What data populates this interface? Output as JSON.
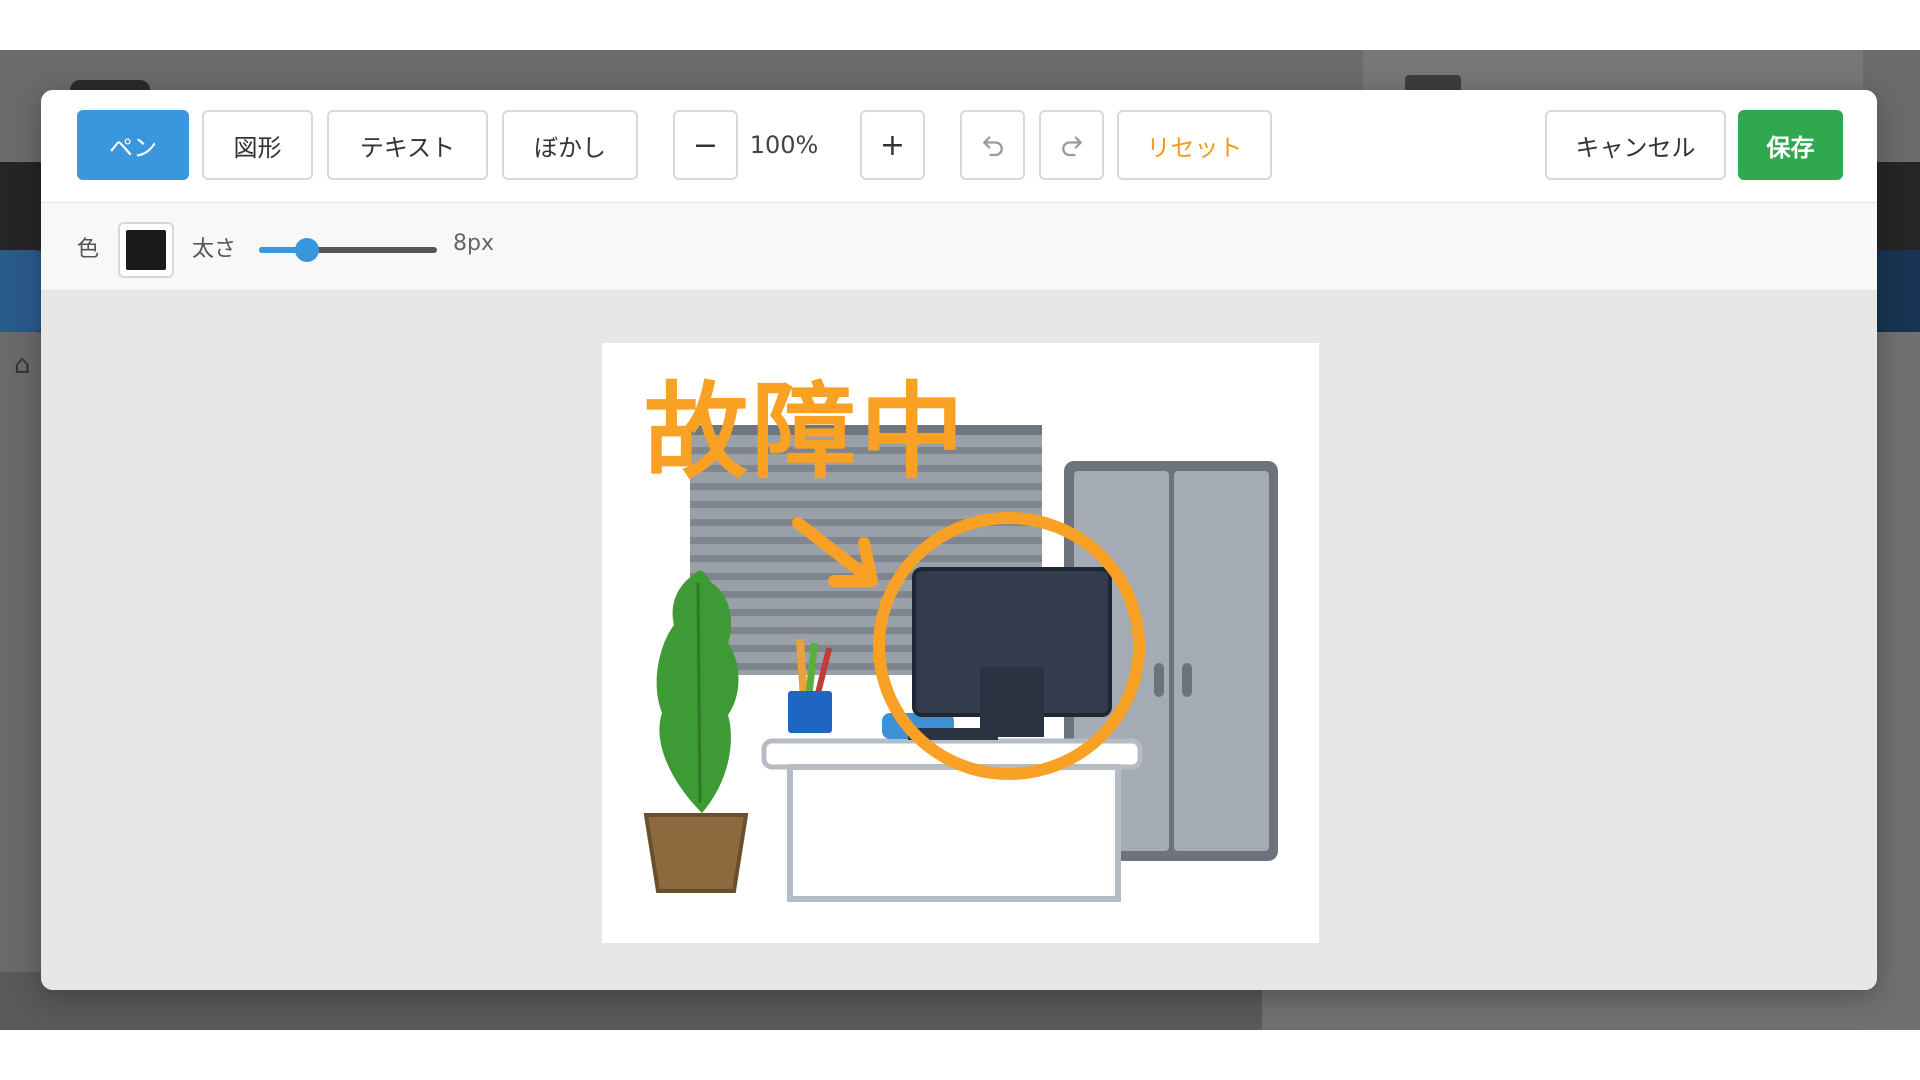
{
  "toolbar": {
    "tools": [
      {
        "label": "ペン",
        "active": true
      },
      {
        "label": "図形",
        "active": false
      },
      {
        "label": "テキスト",
        "active": false
      },
      {
        "label": "ぼかし",
        "active": false
      }
    ],
    "zoom_out_label": "−",
    "zoom_level": "100%",
    "zoom_in_label": "+",
    "undo_icon": "undo-icon",
    "redo_icon": "redo-icon",
    "reset_label": "リセット",
    "cancel_label": "キャンセル",
    "save_label": "保存"
  },
  "options": {
    "color_label": "色",
    "color_value": "#1a1a1a",
    "size_label": "太さ",
    "size_value": "8px",
    "size_fraction": 0.27
  },
  "canvas": {
    "annotation_text": "故障中",
    "annotation_color": "#f8a124"
  },
  "colors": {
    "accent": "#3a97de",
    "save": "#2fa84f",
    "reset": "#f39a1e"
  }
}
